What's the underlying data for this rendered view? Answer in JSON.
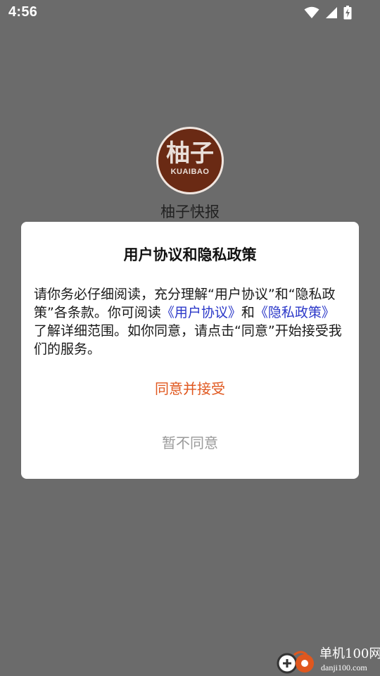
{
  "status_bar": {
    "time": "4:56",
    "icons": [
      "wifi-icon",
      "signal-icon",
      "battery-charging-icon"
    ]
  },
  "app": {
    "logo_text": "柚子",
    "logo_subtext": "KUAIBAO",
    "name": "柚子快报"
  },
  "dialog": {
    "title": "用户协议和隐私政策",
    "body": {
      "part1": "请你务必仔细阅读，充分理解“用户协议”和“隐私政策”各条款。你可阅读",
      "link_user_agreement": "《用户协议》",
      "part2": "和",
      "link_privacy_policy": "《隐私政策》",
      "part3": "了解详细范围。如你同意，请点击“同意”开始接受我们的服务。"
    },
    "accept_label": "同意并接受",
    "decline_label": "暂不同意"
  },
  "watermark": {
    "title": "单机100网",
    "url": "danji100.com"
  },
  "colors": {
    "overlay": "#6b6b6b",
    "accent": "#e0571e",
    "link": "#2a37c8",
    "logo": "#6a2a14"
  }
}
